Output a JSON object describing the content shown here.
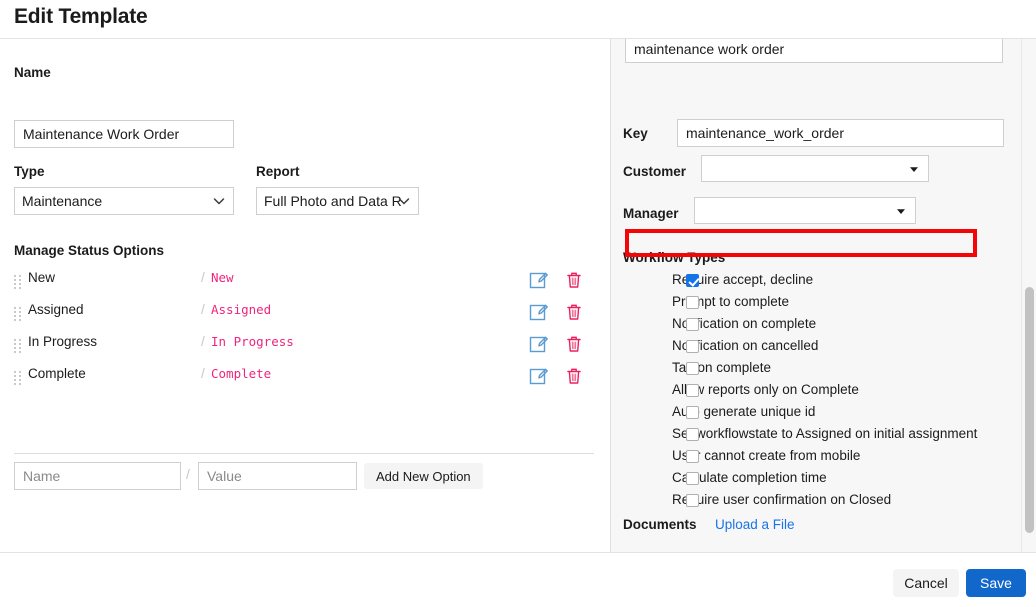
{
  "header": {
    "title": "Edit Template"
  },
  "left": {
    "name_label": "Name",
    "name_value": "Maintenance Work Order",
    "type_label": "Type",
    "type_value": "Maintenance",
    "report_label": "Report",
    "report_value": "Full Photo and Data R",
    "status_heading": "Manage Status Options",
    "slash": "/",
    "status_rows": [
      {
        "name": "New",
        "value": "New"
      },
      {
        "name": "Assigned",
        "value": "Assigned"
      },
      {
        "name": "In Progress",
        "value": "In Progress"
      },
      {
        "name": "Complete",
        "value": "Complete"
      }
    ],
    "new_name_placeholder": "Name",
    "new_value_placeholder": "Value",
    "add_option_label": "Add New Option"
  },
  "right": {
    "top_input_value": "maintenance work order",
    "key_label": "Key",
    "key_value": "maintenance_work_order",
    "customer_label": "Customer",
    "customer_value": "",
    "manager_label": "Manager",
    "manager_value": "",
    "workflow_heading": "Workflow Types",
    "workflow_items": [
      {
        "label": "Require accept, decline",
        "checked": true
      },
      {
        "label": "Prompt to complete",
        "checked": false
      },
      {
        "label": "Notification on complete",
        "checked": false
      },
      {
        "label": "Notification on cancelled",
        "checked": false
      },
      {
        "label": "Tag on complete",
        "checked": false
      },
      {
        "label": "Allow reports only on Complete",
        "checked": false
      },
      {
        "label": "Auto generate unique id",
        "checked": false
      },
      {
        "label": "Set workflowstate to Assigned on initial assignment",
        "checked": false
      },
      {
        "label": "User cannot create from mobile",
        "checked": false
      },
      {
        "label": "Calculate completion time",
        "checked": false
      },
      {
        "label": "Require user confirmation on Closed",
        "checked": false
      }
    ],
    "documents_label": "Documents",
    "upload_link_label": "Upload a File"
  },
  "footer": {
    "cancel_label": "Cancel",
    "save_label": "Save"
  },
  "colors": {
    "accent_blue": "#1267cb",
    "link_blue": "#1a73e8",
    "status_value_pink": "#f0257e",
    "delete_icon_red": "#e8205f",
    "edit_icon_blue": "#5b9bd5",
    "highlight_red": "#f50606",
    "panel_bg": "#f7f7f7"
  }
}
